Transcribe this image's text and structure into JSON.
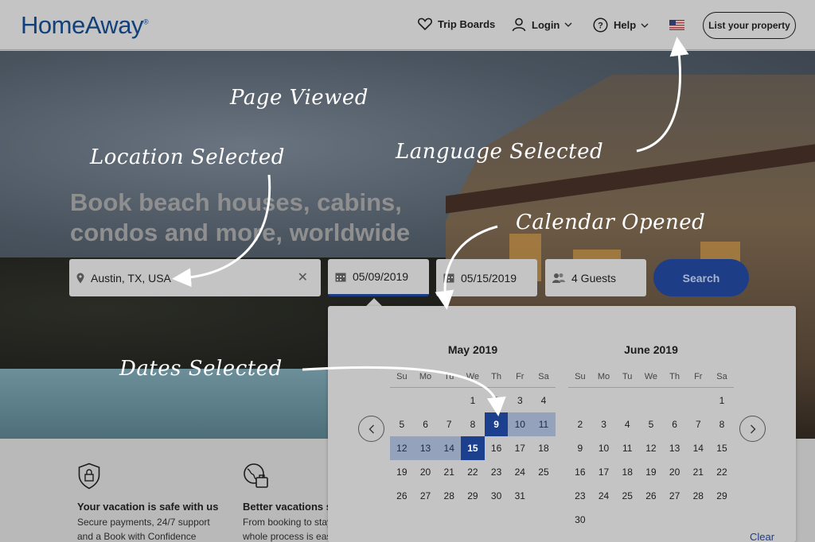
{
  "header": {
    "logo": "HomeAway",
    "nav": {
      "trip_boards": "Trip Boards",
      "login": "Login",
      "help": "Help"
    },
    "list_property": "List your property"
  },
  "hero": {
    "headline": "Book beach houses, cabins, condos and more, worldwide"
  },
  "search": {
    "location": "Austin, TX, USA",
    "check_in": "05/09/2019",
    "check_out": "05/15/2019",
    "guests": "4 Guests",
    "button": "Search"
  },
  "calendar": {
    "weekdays": [
      "Su",
      "Mo",
      "Tu",
      "We",
      "Th",
      "Fr",
      "Sa"
    ],
    "months": [
      {
        "title": "May 2019",
        "offset": 3,
        "days": 31,
        "selected_start": 9,
        "selected_end": 15
      },
      {
        "title": "June 2019",
        "offset": 6,
        "days": 30
      }
    ],
    "clear": "Clear"
  },
  "features": [
    {
      "icon": "shield-lock-icon",
      "title": "Your vacation is safe with us",
      "line1": "Secure payments, 24/7 support",
      "line2": "and a Book with Confidence"
    },
    {
      "icon": "globe-luggage-icon",
      "title": "Better vacations s",
      "line1": "From booking to stay",
      "line2": "whole process is eas"
    }
  ],
  "annotations": {
    "page_viewed": "Page Viewed",
    "location_selected": "Location Selected",
    "language_selected": "Language Selected",
    "calendar_opened": "Calendar Opened",
    "dates_selected": "Dates Selected"
  },
  "colors": {
    "brand_blue": "#1c3f8e",
    "logo_blue": "#12407a",
    "range_fill": "#95a2bb",
    "overlay_gray": "#c4c4c4"
  }
}
